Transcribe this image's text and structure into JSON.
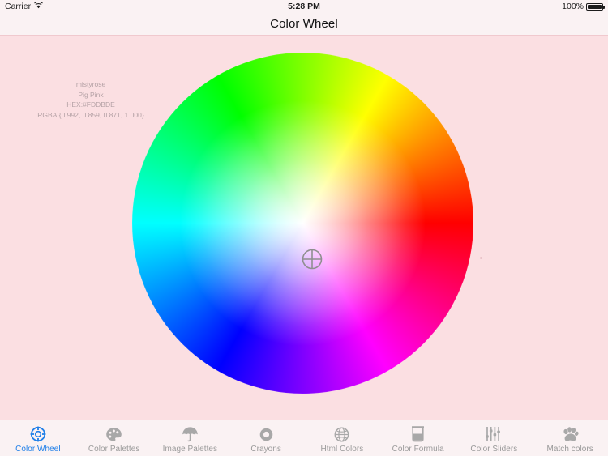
{
  "status_bar": {
    "carrier": "Carrier",
    "wifi_icon": "wifi-icon",
    "time": "5:28 PM",
    "battery_percent": "100%",
    "battery_icon": "battery-full-icon"
  },
  "nav_bar": {
    "title": "Color Wheel"
  },
  "color_info": {
    "name": "mistyrose",
    "alt_name": "Pig Pink",
    "hex": "HEX:#FDDBDE",
    "rgba": "RGBA:{0.992, 0.859, 0.871, 1.000}"
  },
  "canvas": {
    "background_color": "#FDDBDE",
    "wheel": {
      "name": "color-wheel",
      "center_marker_icon": "crosshair-icon",
      "hue_order": [
        "#ff0000",
        "#ffff00",
        "#00ff00",
        "#00ffff",
        "#0000ff",
        "#ff00ff"
      ]
    }
  },
  "tab_bar": {
    "active_color": "#1F7FE8",
    "inactive_color": "#9A9A9A",
    "items": [
      {
        "label": "Color Wheel",
        "icon": "color-wheel-icon",
        "active": true
      },
      {
        "label": "Color Palettes",
        "icon": "palette-icon",
        "active": false
      },
      {
        "label": "Image Palettes",
        "icon": "umbrella-icon",
        "active": false
      },
      {
        "label": "Crayons",
        "icon": "ring-icon",
        "active": false
      },
      {
        "label": "Html Colors",
        "icon": "globe-icon",
        "active": false
      },
      {
        "label": "Color Formula",
        "icon": "beaker-icon",
        "active": false
      },
      {
        "label": "Color Sliders",
        "icon": "sliders-icon",
        "active": false
      },
      {
        "label": "Match colors",
        "icon": "paw-icon",
        "active": false
      }
    ]
  }
}
